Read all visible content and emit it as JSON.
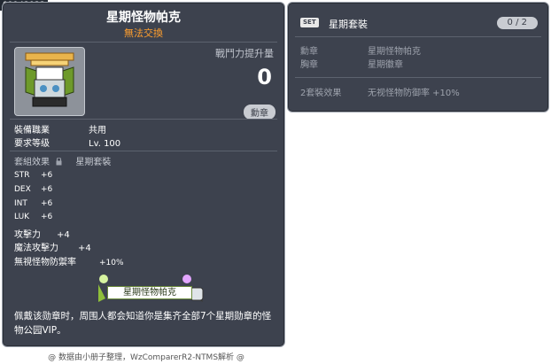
{
  "item_id": "01142922",
  "tooltip": {
    "title": "星期怪物帕克",
    "trade_status": "無法交換",
    "combat_power_label": "戰鬥力提升量",
    "combat_power_value": "0",
    "category_button": "勳章",
    "job_label": "裝備職業",
    "job_value": "共用",
    "level_label": "要求等级",
    "level_value": "Lv. 100",
    "set_effect_label": "套組效果",
    "set_effect_value": "星期套裝",
    "stats": [
      {
        "name": "STR",
        "value": "+6"
      },
      {
        "name": "DEX",
        "value": "+6"
      },
      {
        "name": "INT",
        "value": "+6"
      },
      {
        "name": "LUK",
        "value": "+6"
      },
      {
        "name": "攻擊力",
        "value": "+4"
      },
      {
        "name": "魔法攻擊力",
        "value": "+4"
      },
      {
        "name": "無視怪物防禦率",
        "value": "+10%"
      }
    ],
    "medal_text": "星期怪物帕克",
    "description": "佩戴该勋章时，周围人都会知道你是集齐全部7个星期勋章的怪物公园VIP。"
  },
  "set_panel": {
    "tag": "SET",
    "title": "星期套裝",
    "count": "0 / 2",
    "items": [
      {
        "label": "勳章",
        "value": "星期怪物帕克"
      },
      {
        "label": "胸章",
        "value": "星期徽章"
      }
    ],
    "effect_label": "2套裝效果",
    "effect_value": "无视怪物防御率 +10%"
  },
  "footer": "@ 数据由小册子整理，WzComparerR2-NTMS解析 @",
  "colors": {
    "panel_bg": "#3d424e",
    "trade_status": "#ff9f2e",
    "muted": "#9ea3ad"
  },
  "icons": [
    "lock-icon",
    "medal-item-icon"
  ]
}
